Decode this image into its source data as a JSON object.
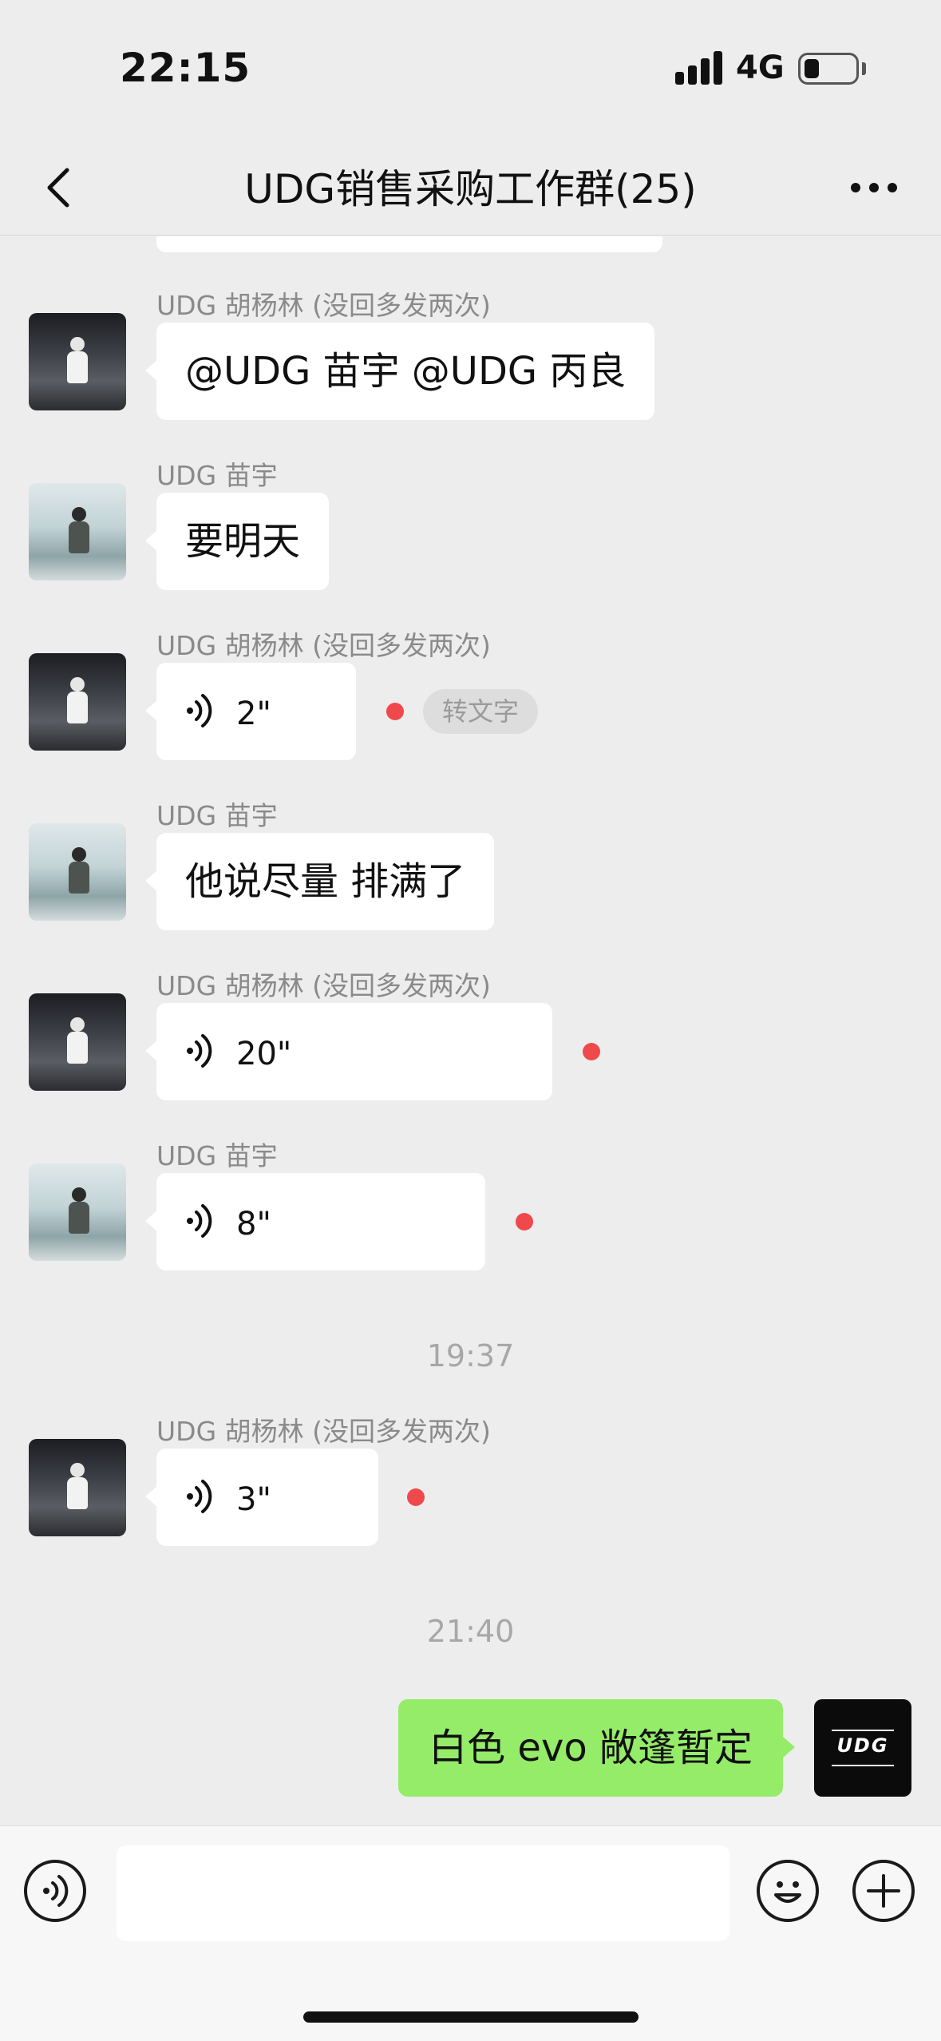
{
  "status_bar": {
    "time": "22:15",
    "network": "4G",
    "battery_level": 0.2
  },
  "nav": {
    "title": "UDG销售采购工作群(25)",
    "back_icon": "chevron-left-icon",
    "more_icon": "more-dots-icon"
  },
  "messages": [
    {
      "sender": "UDG 胡杨林 (没回多发两次)",
      "text": "@UDG  苗宇 @UDG   丙良"
    },
    {
      "sender": "UDG  苗宇",
      "text": "要明天"
    },
    {
      "sender": "UDG 胡杨林 (没回多发两次)",
      "voice": "2\"",
      "convert_label": "转文字"
    },
    {
      "sender": "UDG  苗宇",
      "text": "他说尽量 排满了"
    },
    {
      "sender": "UDG 胡杨林 (没回多发两次)",
      "voice": "20\""
    },
    {
      "sender": "UDG  苗宇",
      "voice": "8\""
    },
    {
      "sender": "UDG 胡杨林 (没回多发两次)",
      "voice": "3\""
    }
  ],
  "timestamps": [
    "19:37",
    "21:40"
  ],
  "my_message": {
    "text": "白色 evo 敞篷暂定",
    "avatar_logo": "UDG"
  },
  "input_bar": {
    "voice_icon": "voice-mode-icon",
    "input_value": "",
    "emoji_icon": "emoji-icon",
    "plus_icon": "plus-icon"
  },
  "colors": {
    "background": "#ededed",
    "my_bubble": "#95ec69",
    "unread_dot": "#f0494c"
  }
}
